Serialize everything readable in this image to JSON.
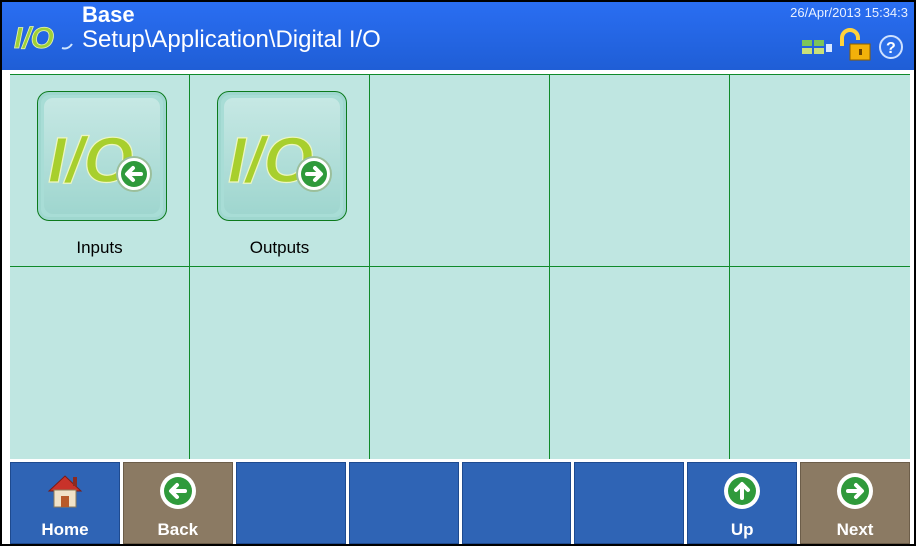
{
  "header": {
    "title": "Base",
    "path": "Setup\\Application\\Digital I/O",
    "datetime": "26/Apr/2013 15:34:3",
    "logo_text": "I/O",
    "icons": [
      "network-status-icon",
      "unlocked-padlock-icon",
      "help-icon"
    ]
  },
  "tiles": [
    {
      "label": "Inputs",
      "icon": "digital-input-icon"
    },
    {
      "label": "Outputs",
      "icon": "digital-output-icon"
    }
  ],
  "softkeys": [
    {
      "label": "Home",
      "icon": "home-icon",
      "color": "#2f64b5"
    },
    {
      "label": "Back",
      "icon": "back-arrow-icon",
      "color": "#8b7a63"
    },
    {
      "label": "",
      "icon": "",
      "color": "#2f64b5"
    },
    {
      "label": "",
      "icon": "",
      "color": "#2f64b5"
    },
    {
      "label": "",
      "icon": "",
      "color": "#2f64b5"
    },
    {
      "label": "",
      "icon": "",
      "color": "#2f64b5"
    },
    {
      "label": "Up",
      "icon": "up-arrow-icon",
      "color": "#2f64b5"
    },
    {
      "label": "Next",
      "icon": "next-arrow-icon",
      "color": "#8b7a63"
    }
  ],
  "colors": {
    "header_blue": "#1f5ed6",
    "grid_bg": "#bfe6e1",
    "grid_line": "#0f8a2a",
    "softkey_blue": "#2f64b5",
    "softkey_brown": "#8b7a63"
  }
}
